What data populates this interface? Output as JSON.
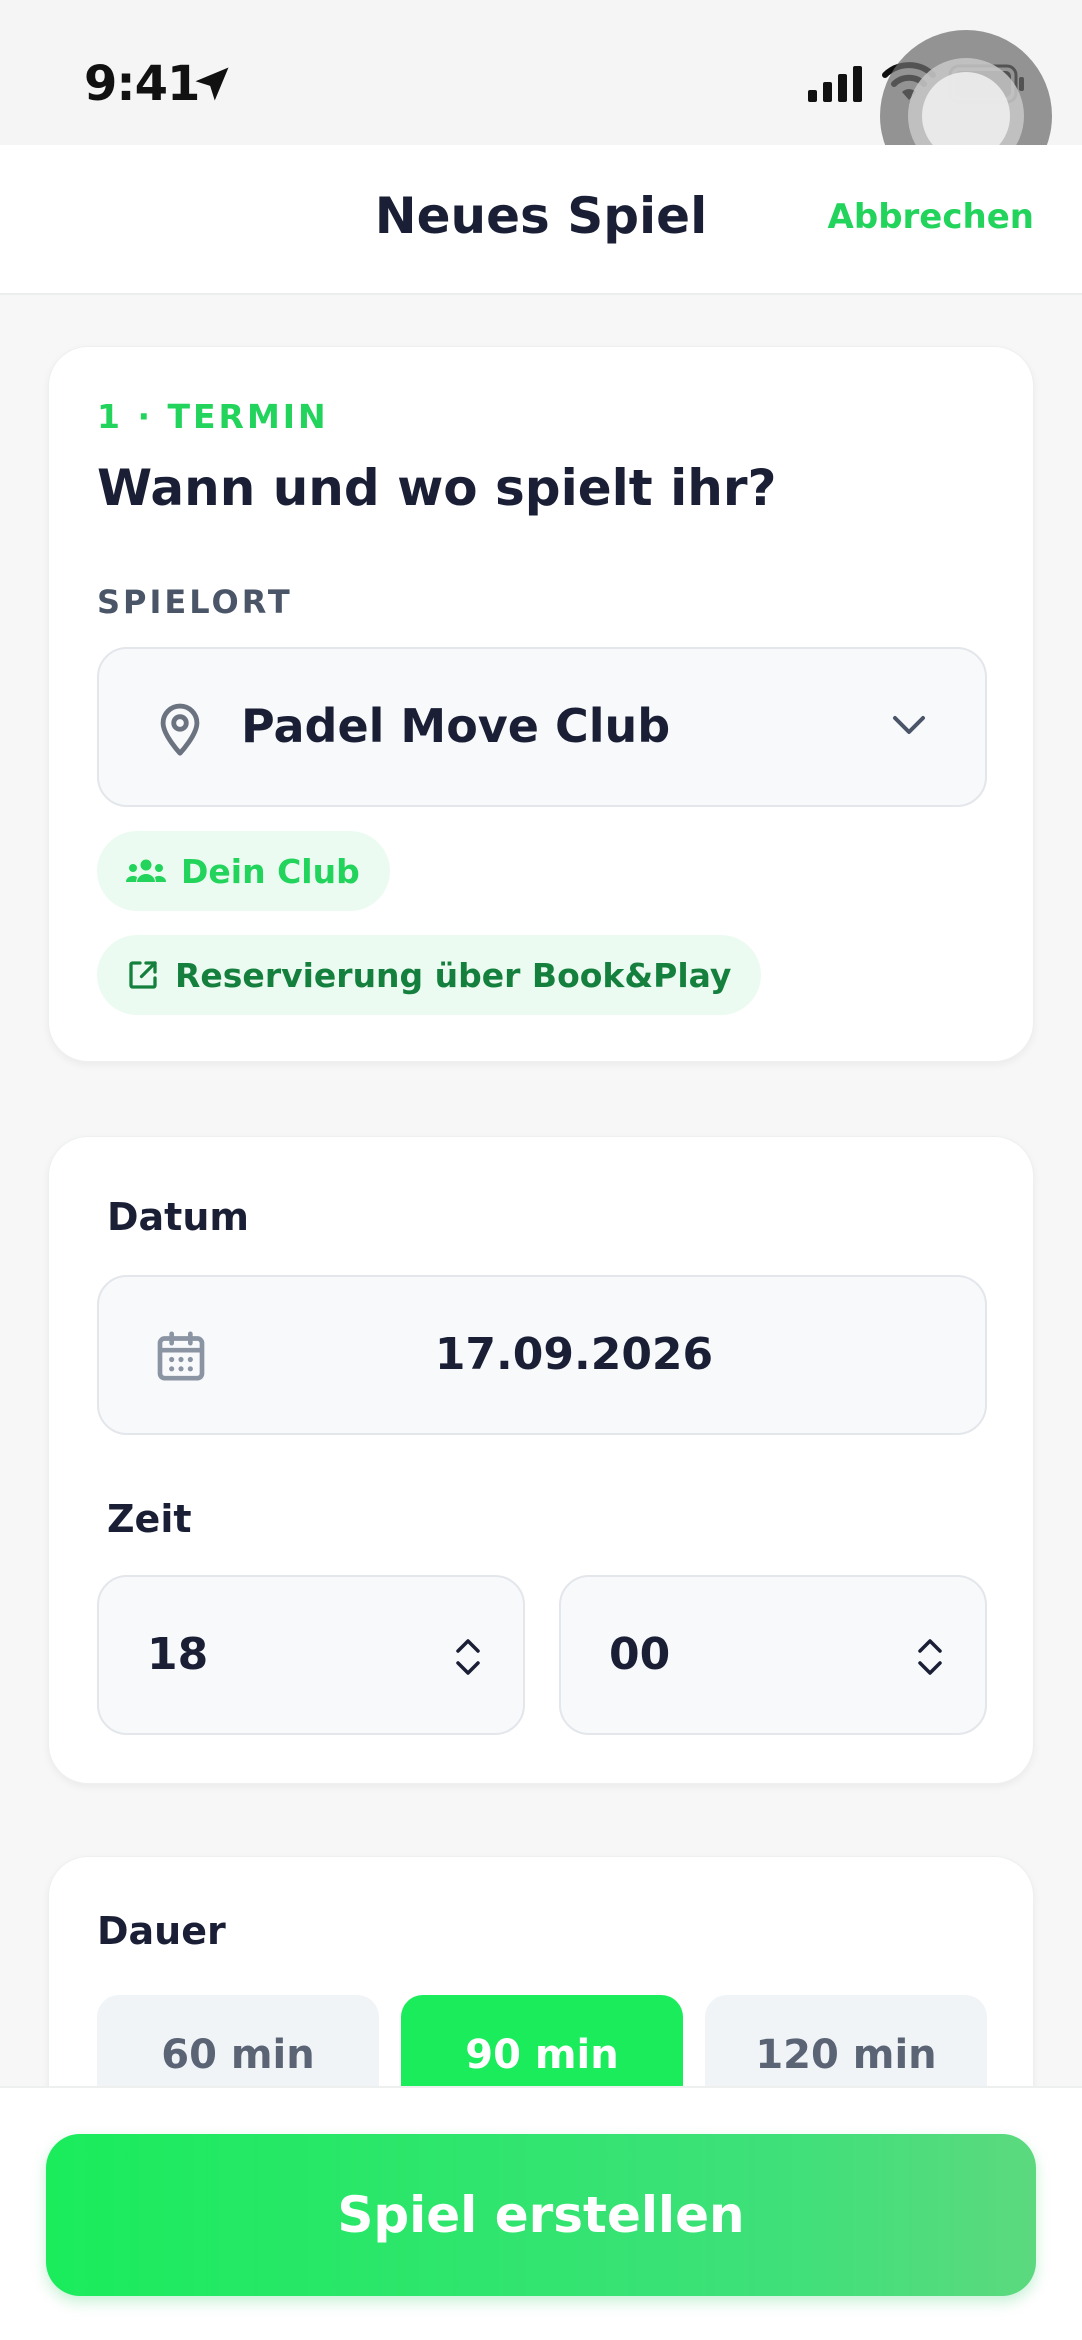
{
  "status_bar": {
    "time": "9:41",
    "icons": [
      "location-arrow-icon",
      "cellular-signal-icon",
      "wifi-icon",
      "battery-icon",
      "assistive-touch-icon"
    ]
  },
  "header": {
    "title": "Neues Spiel",
    "cancel_label": "Abbrechen"
  },
  "step_card": {
    "step_label": "1 · TERMIN",
    "question": "Wann und wo spielt ihr?",
    "location_caption": "SPIELORT",
    "location_value": "Padel Move Club",
    "club_badge": "Dein Club",
    "booking_badge": "Reservierung über Book&Play"
  },
  "datetime_card": {
    "date_label": "Datum",
    "date_value": "17.09.2026",
    "time_label": "Zeit",
    "hour_value": "18",
    "minute_value": "00"
  },
  "duration_card": {
    "label": "Dauer",
    "options": [
      "60 min",
      "90 min",
      "120 min"
    ],
    "selected": "90 min"
  },
  "footer": {
    "create_label": "Spiel erstellen"
  },
  "colors": {
    "accent_green": "#22d35c",
    "button_green": "#1aec5c",
    "text_dark": "#1a1f36",
    "muted": "#4a5568"
  }
}
